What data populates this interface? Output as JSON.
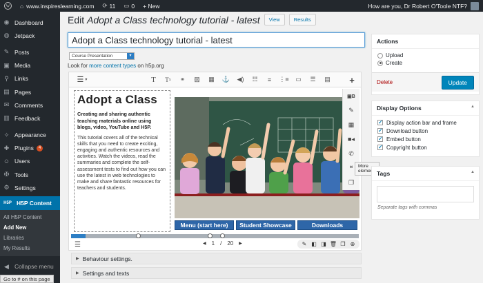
{
  "adminbar": {
    "wp_logo": "wordpress-icon",
    "site": "www.inspireslearning.com",
    "updates_count": "11",
    "comments_count": "0",
    "new_label": "+ New",
    "greeting": "How are you, Dr Robert O'Toole NTF?"
  },
  "sidebar": {
    "items": [
      {
        "label": "Dashboard",
        "icon": "◉"
      },
      {
        "label": "Jetpack",
        "icon": "◍"
      },
      {
        "label": "Posts",
        "icon": "✎"
      },
      {
        "label": "Media",
        "icon": "▣"
      },
      {
        "label": "Links",
        "icon": "⚲"
      },
      {
        "label": "Pages",
        "icon": "▤"
      },
      {
        "label": "Comments",
        "icon": "✉"
      },
      {
        "label": "Feedback",
        "icon": "▥"
      },
      {
        "label": "Appearance",
        "icon": "✧"
      },
      {
        "label": "Plugins",
        "icon": "✚",
        "badge": "4"
      },
      {
        "label": "Users",
        "icon": "☺"
      },
      {
        "label": "Tools",
        "icon": "✠"
      },
      {
        "label": "Settings",
        "icon": "⚙"
      }
    ],
    "current": {
      "label": "H5P Content",
      "icon": "H5P"
    },
    "submenu": [
      "All H5P Content",
      "Add New",
      "Libraries",
      "My Results"
    ],
    "collapse": "Collapse menu",
    "status": "Go to # on this page"
  },
  "header": {
    "title_prefix": "Edit ",
    "title_italic": "Adopt a Class technology tutorial - latest",
    "view_label": "View",
    "results_label": "Results"
  },
  "title_input_value": "Adopt a Class technology tutorial - latest",
  "content_type": "Course Presentation",
  "lookfor": {
    "prefix": "Look for ",
    "link": "more content types",
    "suffix": " on h5p.org"
  },
  "editor": {
    "slide_title": "Adopt a Class",
    "lead": "Creating and sharing authentic teaching materials online using blogs, video, YouTube and H5P.",
    "body": "This tutorial covers all of the technical skills that you need to create exciting, engaging and authentic resources and activities. Watch the videos, read the summaries and complete the self-assessment tests to find out how you can use the latest in web technologies to make and share fantastic resources for teachers and students.",
    "buttons": [
      "Menu (start here)",
      "Student Showcase",
      "Downloads"
    ],
    "tooltip": "More elements",
    "page_current": "1",
    "page_sep": "/",
    "page_total": "20",
    "progress": 0.05
  },
  "accordions": [
    "Behaviour settings.",
    "Settings and texts"
  ],
  "actions": {
    "title": "Actions",
    "upload": "Upload",
    "create": "Create",
    "delete": "Delete",
    "update": "Update"
  },
  "display_options": {
    "title": "Display Options",
    "items": [
      "Display action bar and frame",
      "Download button",
      "Embed button",
      "Copyright button"
    ]
  },
  "tags": {
    "title": "Tags",
    "hint": "Separate tags with commas"
  }
}
